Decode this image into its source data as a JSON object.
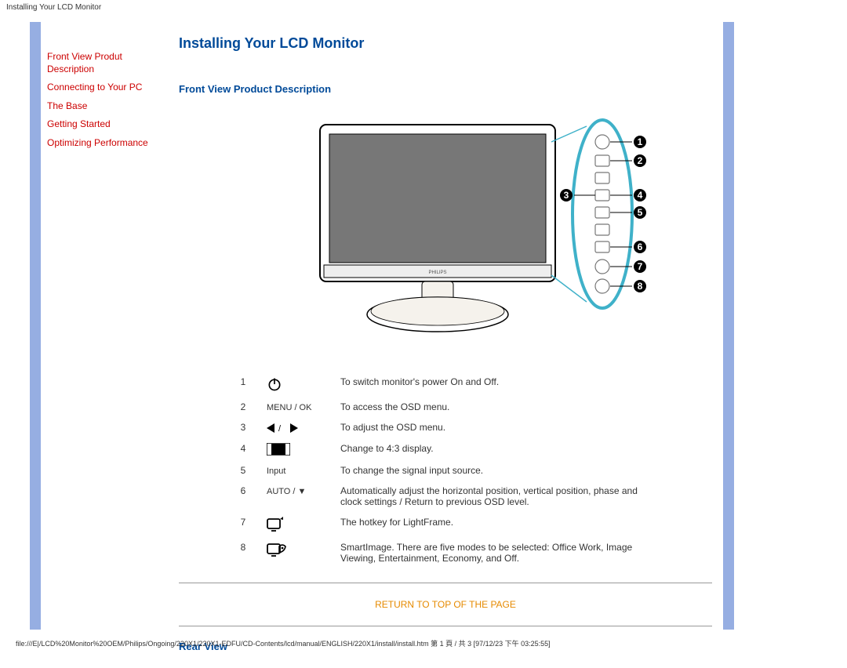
{
  "header": "Installing Your LCD Monitor",
  "sidebar": {
    "items": [
      {
        "label": "Front View Produt Description"
      },
      {
        "label": "Connecting to Your PC"
      },
      {
        "label": "The Base"
      },
      {
        "label": "Getting Started"
      },
      {
        "label": "Optimizing Performance"
      }
    ]
  },
  "page": {
    "title": "Installing Your LCD Monitor",
    "section_front": "Front View Product Description",
    "section_rear": "Rear View",
    "return_top": "RETURN TO TOP OF THE PAGE"
  },
  "controls": [
    {
      "num": "1",
      "symbol_type": "power",
      "symbol_text": "",
      "desc": "To switch monitor's power On and Off."
    },
    {
      "num": "2",
      "symbol_type": "text",
      "symbol_text": "MENU / OK",
      "desc": "To access the OSD menu."
    },
    {
      "num": "3",
      "symbol_type": "arrows",
      "symbol_text": "",
      "desc": "To adjust the OSD menu."
    },
    {
      "num": "4",
      "symbol_type": "aspect",
      "symbol_text": "",
      "desc": "Change to 4:3 display."
    },
    {
      "num": "5",
      "symbol_type": "text",
      "symbol_text": "Input",
      "desc": "To change the signal input source."
    },
    {
      "num": "6",
      "symbol_type": "text",
      "symbol_text": "AUTO / ▼",
      "desc": "Automatically adjust the horizontal position, vertical position, phase and clock settings / Return to previous OSD level."
    },
    {
      "num": "7",
      "symbol_type": "lightframe",
      "symbol_text": "",
      "desc": "The hotkey for LightFrame."
    },
    {
      "num": "8",
      "symbol_type": "smartimage",
      "symbol_text": "",
      "desc": "SmartImage. There are five modes to be selected: Office Work, Image Viewing, Entertainment, Economy, and Off."
    }
  ],
  "callouts": [
    "1",
    "2",
    "3",
    "4",
    "5",
    "6",
    "7",
    "8"
  ],
  "monitor_brand": "PHILIPS",
  "footer_path": "file:///E|/LCD%20Monitor%20OEM/Philips/Ongoing/220X1/220X1-EDFU/CD-Contents/lcd/manual/ENGLISH/220X1/install/install.htm 第 1 頁 / 共 3 [97/12/23 下午 03:25:55]"
}
